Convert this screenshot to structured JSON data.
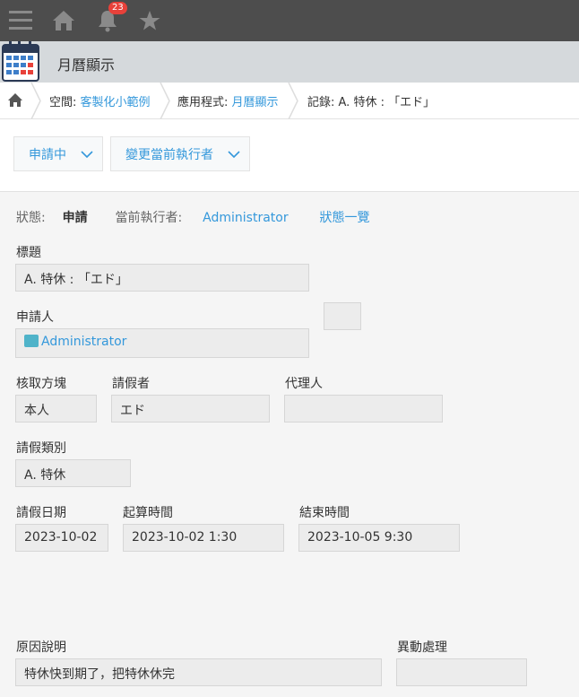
{
  "topbar": {
    "notification_count": "23",
    "icons": [
      "menu-icon",
      "home-icon",
      "bell-icon",
      "star-icon"
    ]
  },
  "app": {
    "title": "月曆顯示"
  },
  "breadcrumb": {
    "space_prefix": "空間: ",
    "space_name": "客製化小範例",
    "app_prefix": "應用程式: ",
    "app_name": "月曆顯示",
    "record": "記錄: A. 特休 : 「エド」"
  },
  "actions": {
    "status_button": "申請中",
    "assignee_button": "變更當前執行者"
  },
  "status": {
    "label": "狀態:",
    "value": "申請",
    "assignee_label": "當前執行者:",
    "assignee": "Administrator",
    "history_link": "狀態一覽"
  },
  "fields": {
    "title_label": "標題",
    "title_value": "A. 特休 : 「エド」",
    "applicant_label": "申請人",
    "applicant_value": "Administrator",
    "method_label": "核取方塊",
    "method_value": "本人",
    "requester_label": "請假者",
    "requester_value": "エド",
    "proxy_label": "代理人",
    "proxy_value": "",
    "type_label": "請假類別",
    "type_value": "A. 特休",
    "date_label": "請假日期",
    "date_value": "2023-10-02",
    "start_label": "起算時間",
    "start_value": "2023-10-02 1:30",
    "end_label": "結束時間",
    "end_value": "2023-10-05 9:30",
    "reason_label": "原因說明",
    "reason_value": "特休快到期了，把特休休完",
    "change_label": "異動處理",
    "change_value": ""
  },
  "colors": {
    "accent": "#3498db",
    "topbar": "#4d4d4d",
    "badge": "#e8413a"
  }
}
